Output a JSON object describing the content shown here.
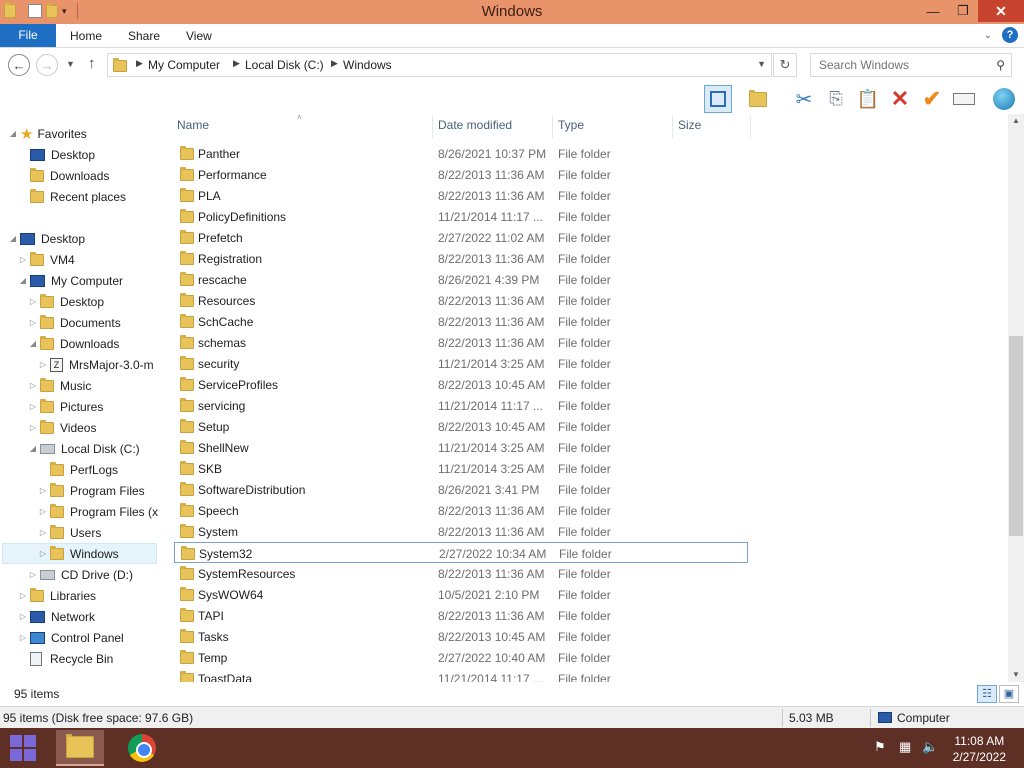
{
  "window": {
    "title": "Windows"
  },
  "ribbon": {
    "file": "File",
    "tabs": [
      "Home",
      "Share",
      "View"
    ]
  },
  "address": {
    "crumbs": [
      "My Computer",
      "Local Disk (C:)",
      "Windows"
    ],
    "search_placeholder": "Search Windows"
  },
  "nav": {
    "favorites": "Favorites",
    "fav_items": [
      "Desktop",
      "Downloads",
      "Recent places"
    ],
    "desktop": "Desktop",
    "vm4": "VM4",
    "mycomputer": "My Computer",
    "mc_items": [
      "Desktop",
      "Documents",
      "Downloads"
    ],
    "mrsmajor": "MrsMajor-3.0-m",
    "mc_items2": [
      "Music",
      "Pictures",
      "Videos"
    ],
    "localdisk": "Local Disk (C:)",
    "ld_items": [
      "PerfLogs",
      "Program Files",
      "Program Files (x",
      "Users",
      "Windows"
    ],
    "cddrive": "CD Drive (D:)",
    "libraries": "Libraries",
    "network": "Network",
    "controlpanel": "Control Panel",
    "recyclebin": "Recycle Bin"
  },
  "columns": {
    "name": "Name",
    "date": "Date modified",
    "type": "Type",
    "size": "Size"
  },
  "files": [
    {
      "name": "Panther",
      "date": "8/26/2021 10:37 PM",
      "type": "File folder"
    },
    {
      "name": "Performance",
      "date": "8/22/2013 11:36 AM",
      "type": "File folder"
    },
    {
      "name": "PLA",
      "date": "8/22/2013 11:36 AM",
      "type": "File folder"
    },
    {
      "name": "PolicyDefinitions",
      "date": "11/21/2014 11:17 ...",
      "type": "File folder"
    },
    {
      "name": "Prefetch",
      "date": "2/27/2022 11:02 AM",
      "type": "File folder"
    },
    {
      "name": "Registration",
      "date": "8/22/2013 11:36 AM",
      "type": "File folder"
    },
    {
      "name": "rescache",
      "date": "8/26/2021 4:39 PM",
      "type": "File folder"
    },
    {
      "name": "Resources",
      "date": "8/22/2013 11:36 AM",
      "type": "File folder"
    },
    {
      "name": "SchCache",
      "date": "8/22/2013 11:36 AM",
      "type": "File folder"
    },
    {
      "name": "schemas",
      "date": "8/22/2013 11:36 AM",
      "type": "File folder"
    },
    {
      "name": "security",
      "date": "11/21/2014 3:25 AM",
      "type": "File folder"
    },
    {
      "name": "ServiceProfiles",
      "date": "8/22/2013 10:45 AM",
      "type": "File folder"
    },
    {
      "name": "servicing",
      "date": "11/21/2014 11:17 ...",
      "type": "File folder"
    },
    {
      "name": "Setup",
      "date": "8/22/2013 10:45 AM",
      "type": "File folder"
    },
    {
      "name": "ShellNew",
      "date": "11/21/2014 3:25 AM",
      "type": "File folder"
    },
    {
      "name": "SKB",
      "date": "11/21/2014 3:25 AM",
      "type": "File folder"
    },
    {
      "name": "SoftwareDistribution",
      "date": "8/26/2021 3:41 PM",
      "type": "File folder"
    },
    {
      "name": "Speech",
      "date": "8/22/2013 11:36 AM",
      "type": "File folder"
    },
    {
      "name": "System",
      "date": "8/22/2013 11:36 AM",
      "type": "File folder"
    },
    {
      "name": "System32",
      "date": "2/27/2022 10:34 AM",
      "type": "File folder"
    },
    {
      "name": "SystemResources",
      "date": "8/22/2013 11:36 AM",
      "type": "File folder"
    },
    {
      "name": "SysWOW64",
      "date": "10/5/2021 2:10 PM",
      "type": "File folder"
    },
    {
      "name": "TAPI",
      "date": "8/22/2013 11:36 AM",
      "type": "File folder"
    },
    {
      "name": "Tasks",
      "date": "8/22/2013 10:45 AM",
      "type": "File folder"
    },
    {
      "name": "Temp",
      "date": "2/27/2022 10:40 AM",
      "type": "File folder"
    },
    {
      "name": "ToastData",
      "date": "11/21/2014 11:17 ...",
      "type": "File folder"
    }
  ],
  "status": {
    "count": "95 items"
  },
  "details": {
    "summary": "95 items (Disk free space: 97.6 GB)",
    "size": "5.03 MB",
    "computer": "Computer"
  },
  "clock": {
    "time": "11:08 AM",
    "date": "2/27/2022"
  },
  "colors": {
    "titlebar": "#e8936a",
    "file_tab": "#1e6fc4",
    "taskbar": "#5e2f25"
  }
}
